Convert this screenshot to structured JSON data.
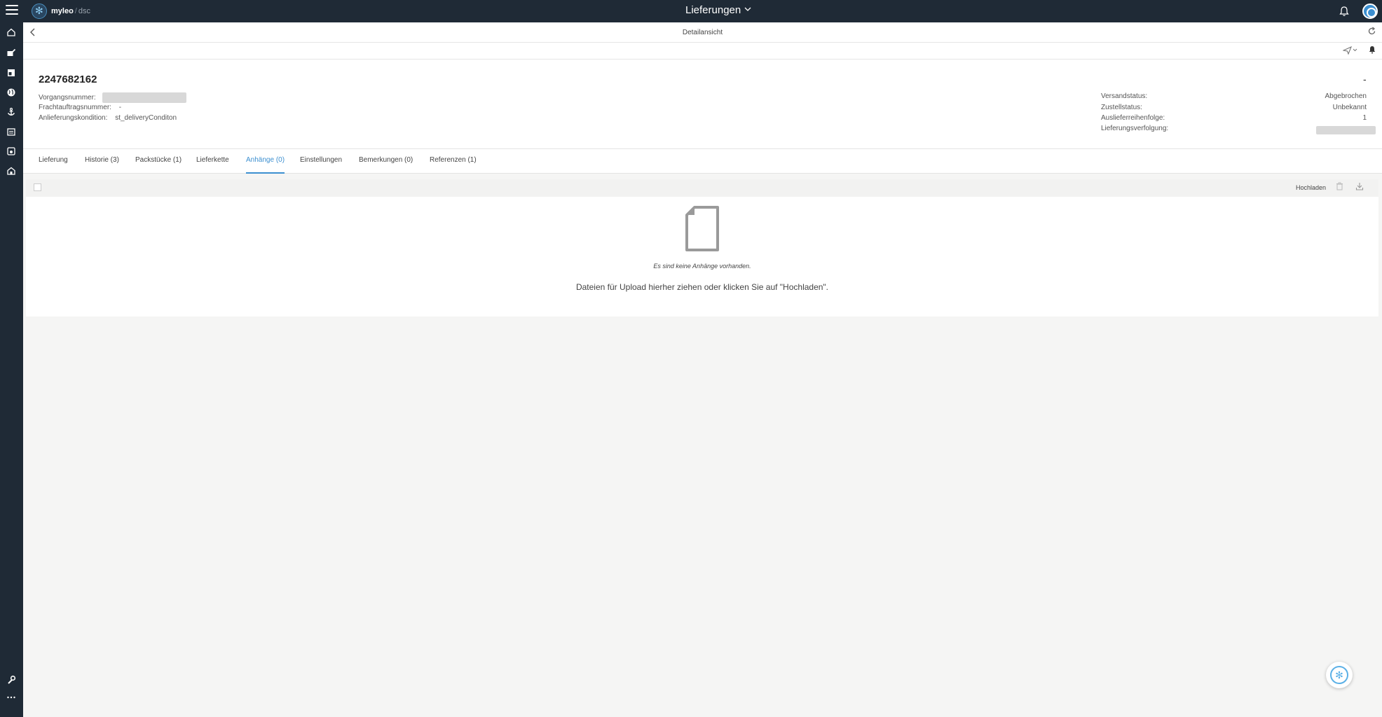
{
  "topbar": {
    "brand": "myleo",
    "brand_sep": "/",
    "brand_sub": "dsc",
    "app_title": "Lieferungen"
  },
  "subheader": {
    "title": "Detailansicht"
  },
  "header": {
    "doc_number": "2247682162",
    "right_value": "-",
    "left_fields": [
      {
        "label": "Vorgangsnummer:",
        "value": ""
      },
      {
        "label": "Frachtauftragsnummer:",
        "value": "-"
      },
      {
        "label": "Anlieferungskondition:",
        "value": "st_deliveryConditon"
      }
    ],
    "right_fields": [
      {
        "label": "Versandstatus:",
        "value": "Abgebrochen"
      },
      {
        "label": "Zustellstatus:",
        "value": "Unbekannt"
      },
      {
        "label": "Auslieferreihenfolge:",
        "value": "1"
      },
      {
        "label": "Lieferungsverfolgung:",
        "value": ""
      }
    ]
  },
  "tabs": [
    {
      "label": "Lieferung"
    },
    {
      "label": "Historie (3)"
    },
    {
      "label": "Packstücke (1)"
    },
    {
      "label": "Lieferkette"
    },
    {
      "label": "Anhänge (0)"
    },
    {
      "label": "Einstellungen"
    },
    {
      "label": "Bemerkungen (0)"
    },
    {
      "label": "Referenzen (1)"
    }
  ],
  "active_tab": "Anhänge (0)",
  "attachments": {
    "upload_label": "Hochladen",
    "empty_title": "Es sind keine Anhänge vorhanden.",
    "empty_hint": "Dateien für Upload hierher ziehen oder klicken Sie auf \"Hochladen\"."
  },
  "colors": {
    "nav_bg": "#1f2a36",
    "accent": "#3c8fd0"
  }
}
